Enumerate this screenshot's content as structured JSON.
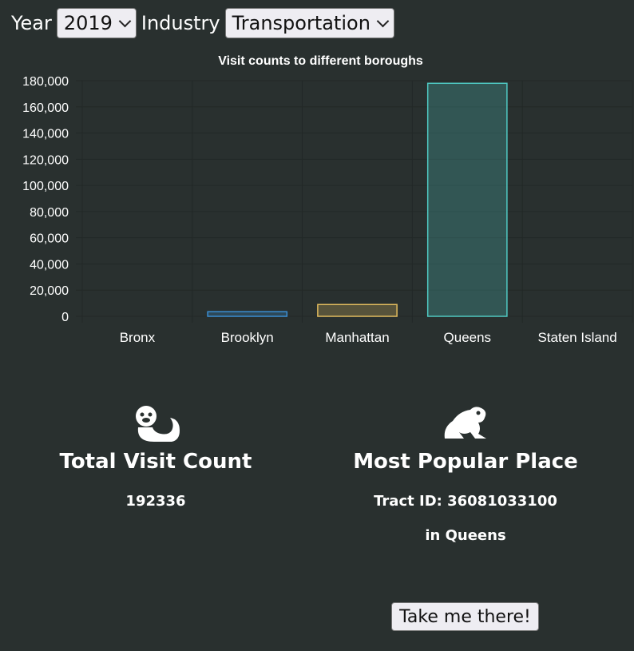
{
  "controls": {
    "year_label": "Year",
    "year_value": "2019",
    "industry_label": "Industry",
    "industry_value": "Transportation"
  },
  "chart_data": {
    "type": "bar",
    "title": "Visit counts to different boroughs",
    "categories": [
      "Bronx",
      "Brooklyn",
      "Manhattan",
      "Queens",
      "Staten Island"
    ],
    "values": [
      0,
      3500,
      9000,
      178000,
      0
    ],
    "ylim": [
      0,
      180000
    ],
    "yticks": [
      "0",
      "20,000",
      "40,000",
      "60,000",
      "80,000",
      "100,000",
      "120,000",
      "140,000",
      "160,000",
      "180,000"
    ],
    "colors": {
      "Bronx": "#e8744f",
      "Brooklyn": "#3b8ed3",
      "Manhattan": "#e3bc5e",
      "Queens": "#4fc8c2",
      "Staten Island": "#8a8a8a"
    },
    "grid": true
  },
  "stats": {
    "total": {
      "icon": "otter-icon",
      "title": "Total Visit Count",
      "value": "192336"
    },
    "popular": {
      "icon": "frog-icon",
      "title": "Most Popular Place",
      "tract": "Tract ID: 36081033100",
      "borough": "in Queens"
    }
  },
  "button": {
    "label": "Take me there!"
  }
}
